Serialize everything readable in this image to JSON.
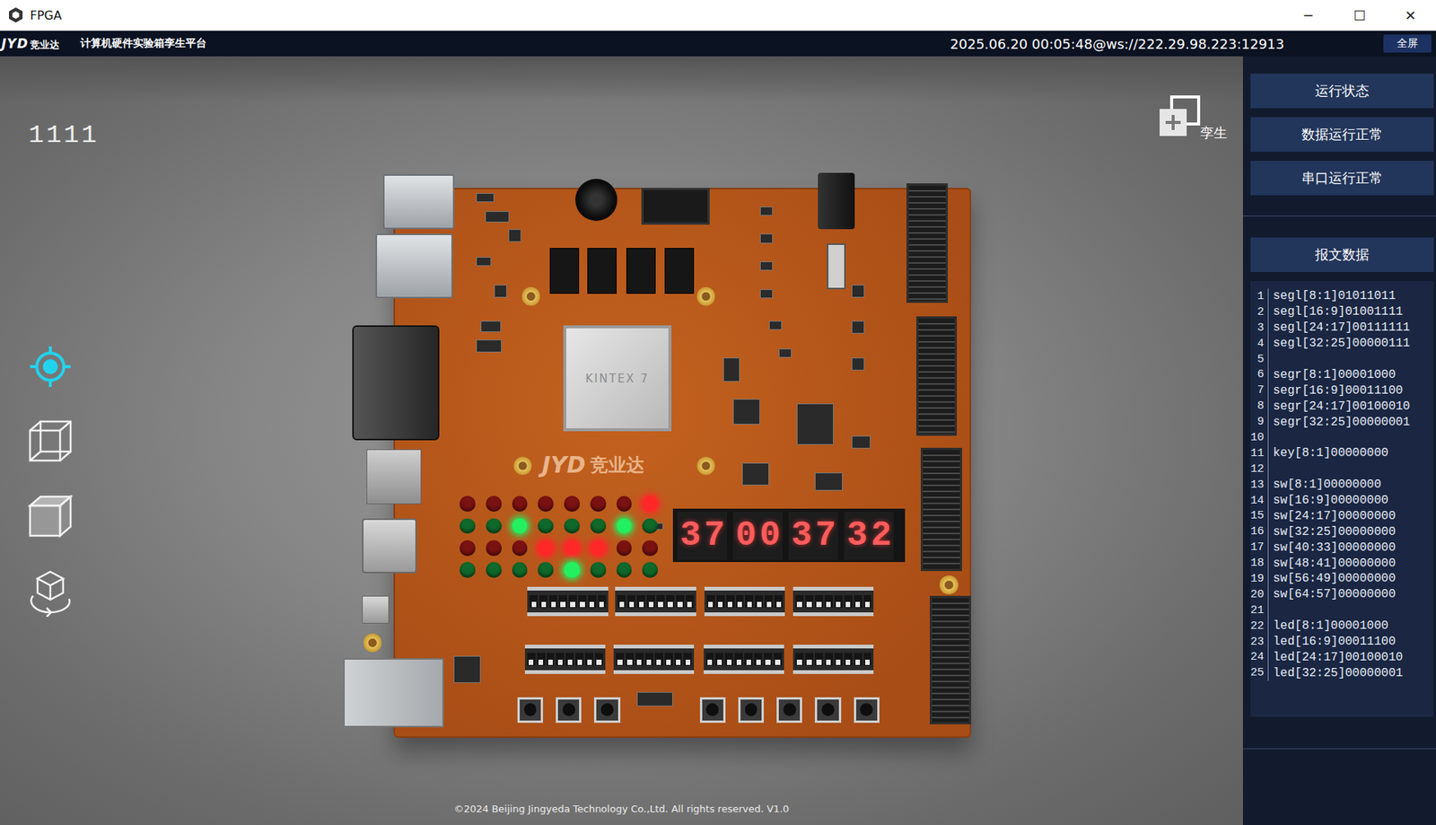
{
  "window": {
    "title": "FPGA",
    "controls": [
      "─",
      "☐",
      "✕"
    ]
  },
  "header": {
    "logo": {
      "mark": "JYD",
      "name": "竞业达"
    },
    "title": "计算机硬件实验箱孪生平台",
    "connection": "2025.06.20 00:05:48@ws://222.29.98.223:12913",
    "fullscreen_button": "全屏"
  },
  "viewport": {
    "counter": "1111",
    "tools": [
      {
        "kind": "locate",
        "selected": true
      },
      {
        "kind": "wireframe",
        "selected": false
      },
      {
        "kind": "solid",
        "selected": false
      },
      {
        "kind": "rotate",
        "selected": false
      }
    ],
    "twin_button": "孪生",
    "footer": "©2024 Beijing Jingyeda Technology Co.,Ltd. All rights reserved. V1.0"
  },
  "board": {
    "chip_label": "KINTEX 7",
    "logo": {
      "mark": "JYD",
      "name": "竞业达"
    },
    "seven_segment": "37003732",
    "leds": [
      [
        {
          "on": false,
          "color": "#e02020"
        },
        {
          "on": false,
          "color": "#e02020"
        },
        {
          "on": false,
          "color": "#e02020"
        },
        {
          "on": false,
          "color": "#e02020"
        },
        {
          "on": false,
          "color": "#e02020"
        },
        {
          "on": false,
          "color": "#e02020"
        },
        {
          "on": false,
          "color": "#e02020"
        },
        {
          "on": true,
          "color": "#e02020"
        }
      ],
      [
        {
          "on": false,
          "color": "#1cbf4c"
        },
        {
          "on": false,
          "color": "#1cbf4c"
        },
        {
          "on": true,
          "color": "#1cbf4c"
        },
        {
          "on": false,
          "color": "#1cbf4c"
        },
        {
          "on": false,
          "color": "#1cbf4c"
        },
        {
          "on": false,
          "color": "#1cbf4c"
        },
        {
          "on": true,
          "color": "#1cbf4c"
        },
        {
          "on": false,
          "color": "#1cbf4c"
        }
      ],
      [
        {
          "on": false,
          "color": "#e02020"
        },
        {
          "on": false,
          "color": "#e02020"
        },
        {
          "on": false,
          "color": "#e02020"
        },
        {
          "on": true,
          "color": "#e02020"
        },
        {
          "on": true,
          "color": "#e02020"
        },
        {
          "on": true,
          "color": "#e02020"
        },
        {
          "on": false,
          "color": "#e02020"
        },
        {
          "on": false,
          "color": "#e02020"
        }
      ],
      [
        {
          "on": false,
          "color": "#1cbf4c"
        },
        {
          "on": false,
          "color": "#1cbf4c"
        },
        {
          "on": false,
          "color": "#1cbf4c"
        },
        {
          "on": false,
          "color": "#1cbf4c"
        },
        {
          "on": true,
          "color": "#1cbf4c"
        },
        {
          "on": false,
          "color": "#1cbf4c"
        },
        {
          "on": false,
          "color": "#1cbf4c"
        },
        {
          "on": false,
          "color": "#1cbf4c"
        }
      ]
    ],
    "dip_banks": [
      {
        "switches": [
          false,
          false,
          false,
          false,
          false,
          false,
          false,
          false
        ]
      },
      {
        "switches": [
          false,
          false,
          false,
          false,
          false,
          false,
          false,
          false
        ]
      },
      {
        "switches": [
          false,
          false,
          false,
          false,
          false,
          false,
          false,
          false
        ]
      },
      {
        "switches": [
          false,
          false,
          false,
          false,
          false,
          false,
          false,
          false
        ]
      },
      {
        "switches": [
          false,
          false,
          false,
          false,
          false,
          false,
          false,
          false
        ]
      },
      {
        "switches": [
          false,
          false,
          false,
          false,
          false,
          false,
          false,
          false
        ]
      },
      {
        "switches": [
          false,
          false,
          false,
          false,
          false,
          false,
          false,
          false
        ]
      },
      {
        "switches": [
          false,
          false,
          false,
          false,
          false,
          false,
          false,
          false
        ]
      }
    ],
    "buttons": [
      {
        "pressed": false
      },
      {
        "pressed": false
      },
      {
        "pressed": false
      },
      {
        "pressed": false
      },
      {
        "pressed": false
      },
      {
        "pressed": false
      },
      {
        "pressed": false
      },
      {
        "pressed": false
      }
    ]
  },
  "status_panel": {
    "status_buttons": [
      "运行状态",
      "数据运行正常",
      "串口运行正常"
    ],
    "message_title": "报文数据",
    "message_lines": [
      {
        "number": "1",
        "text": "segl[8:1]01011011"
      },
      {
        "number": "2",
        "text": "segl[16:9]01001111"
      },
      {
        "number": "3",
        "text": "segl[24:17]00111111"
      },
      {
        "number": "4",
        "text": "segl[32:25]00000111"
      },
      {
        "number": "5",
        "text": ""
      },
      {
        "number": "6",
        "text": "segr[8:1]00001000"
      },
      {
        "number": "7",
        "text": "segr[16:9]00011100"
      },
      {
        "number": "8",
        "text": "segr[24:17]00100010"
      },
      {
        "number": "9",
        "text": "segr[32:25]00000001"
      },
      {
        "number": "10",
        "text": ""
      },
      {
        "number": "11",
        "text": "key[8:1]00000000"
      },
      {
        "number": "12",
        "text": ""
      },
      {
        "number": "13",
        "text": "sw[8:1]00000000"
      },
      {
        "number": "14",
        "text": "sw[16:9]00000000"
      },
      {
        "number": "15",
        "text": "sw[24:17]00000000"
      },
      {
        "number": "16",
        "text": "sw[32:25]00000000"
      },
      {
        "number": "17",
        "text": "sw[40:33]00000000"
      },
      {
        "number": "18",
        "text": "sw[48:41]00000000"
      },
      {
        "number": "19",
        "text": "sw[56:49]00000000"
      },
      {
        "number": "20",
        "text": "sw[64:57]00000000"
      },
      {
        "number": "21",
        "text": ""
      },
      {
        "number": "22",
        "text": "led[8:1]00001000"
      },
      {
        "number": "23",
        "text": "led[16:9]00011100"
      },
      {
        "number": "24",
        "text": "led[24:17]00100010"
      },
      {
        "number": "25",
        "text": "led[32:25]00000001"
      }
    ]
  }
}
